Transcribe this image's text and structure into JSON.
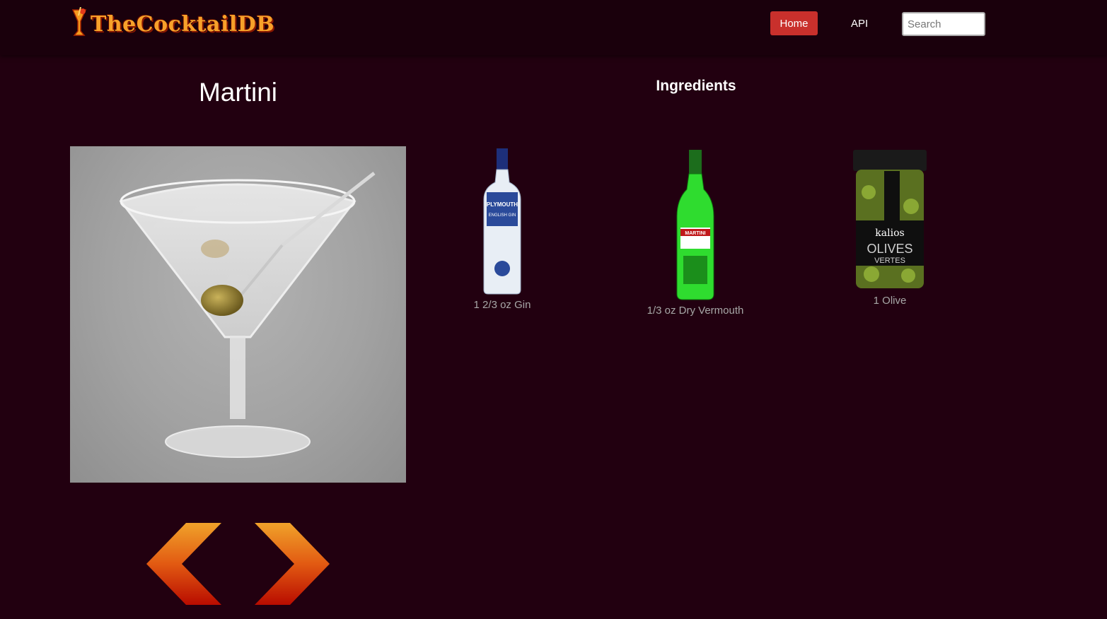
{
  "nav": {
    "logo_text": "TheCocktailDB",
    "home_label": "Home",
    "api_label": "API",
    "search_placeholder": "Search"
  },
  "drink": {
    "name": "Martini",
    "prev_icon": "chevron-left-icon",
    "next_icon": "chevron-right-icon"
  },
  "ingredients": {
    "heading": "Ingredients",
    "items": [
      {
        "label": "1 2/3 oz Gin",
        "icon": "gin-bottle-icon"
      },
      {
        "label": "1/3 oz Dry Vermouth",
        "icon": "vermouth-bottle-icon"
      },
      {
        "label": "1 Olive",
        "icon": "olive-jar-icon"
      }
    ]
  },
  "colors": {
    "background": "#220010",
    "navbar": "#1a000c",
    "accent": "#c9302c",
    "arrow_top": "#f0a22a",
    "arrow_bottom": "#b80c00",
    "ingredient_text": "#a7a7a7"
  }
}
